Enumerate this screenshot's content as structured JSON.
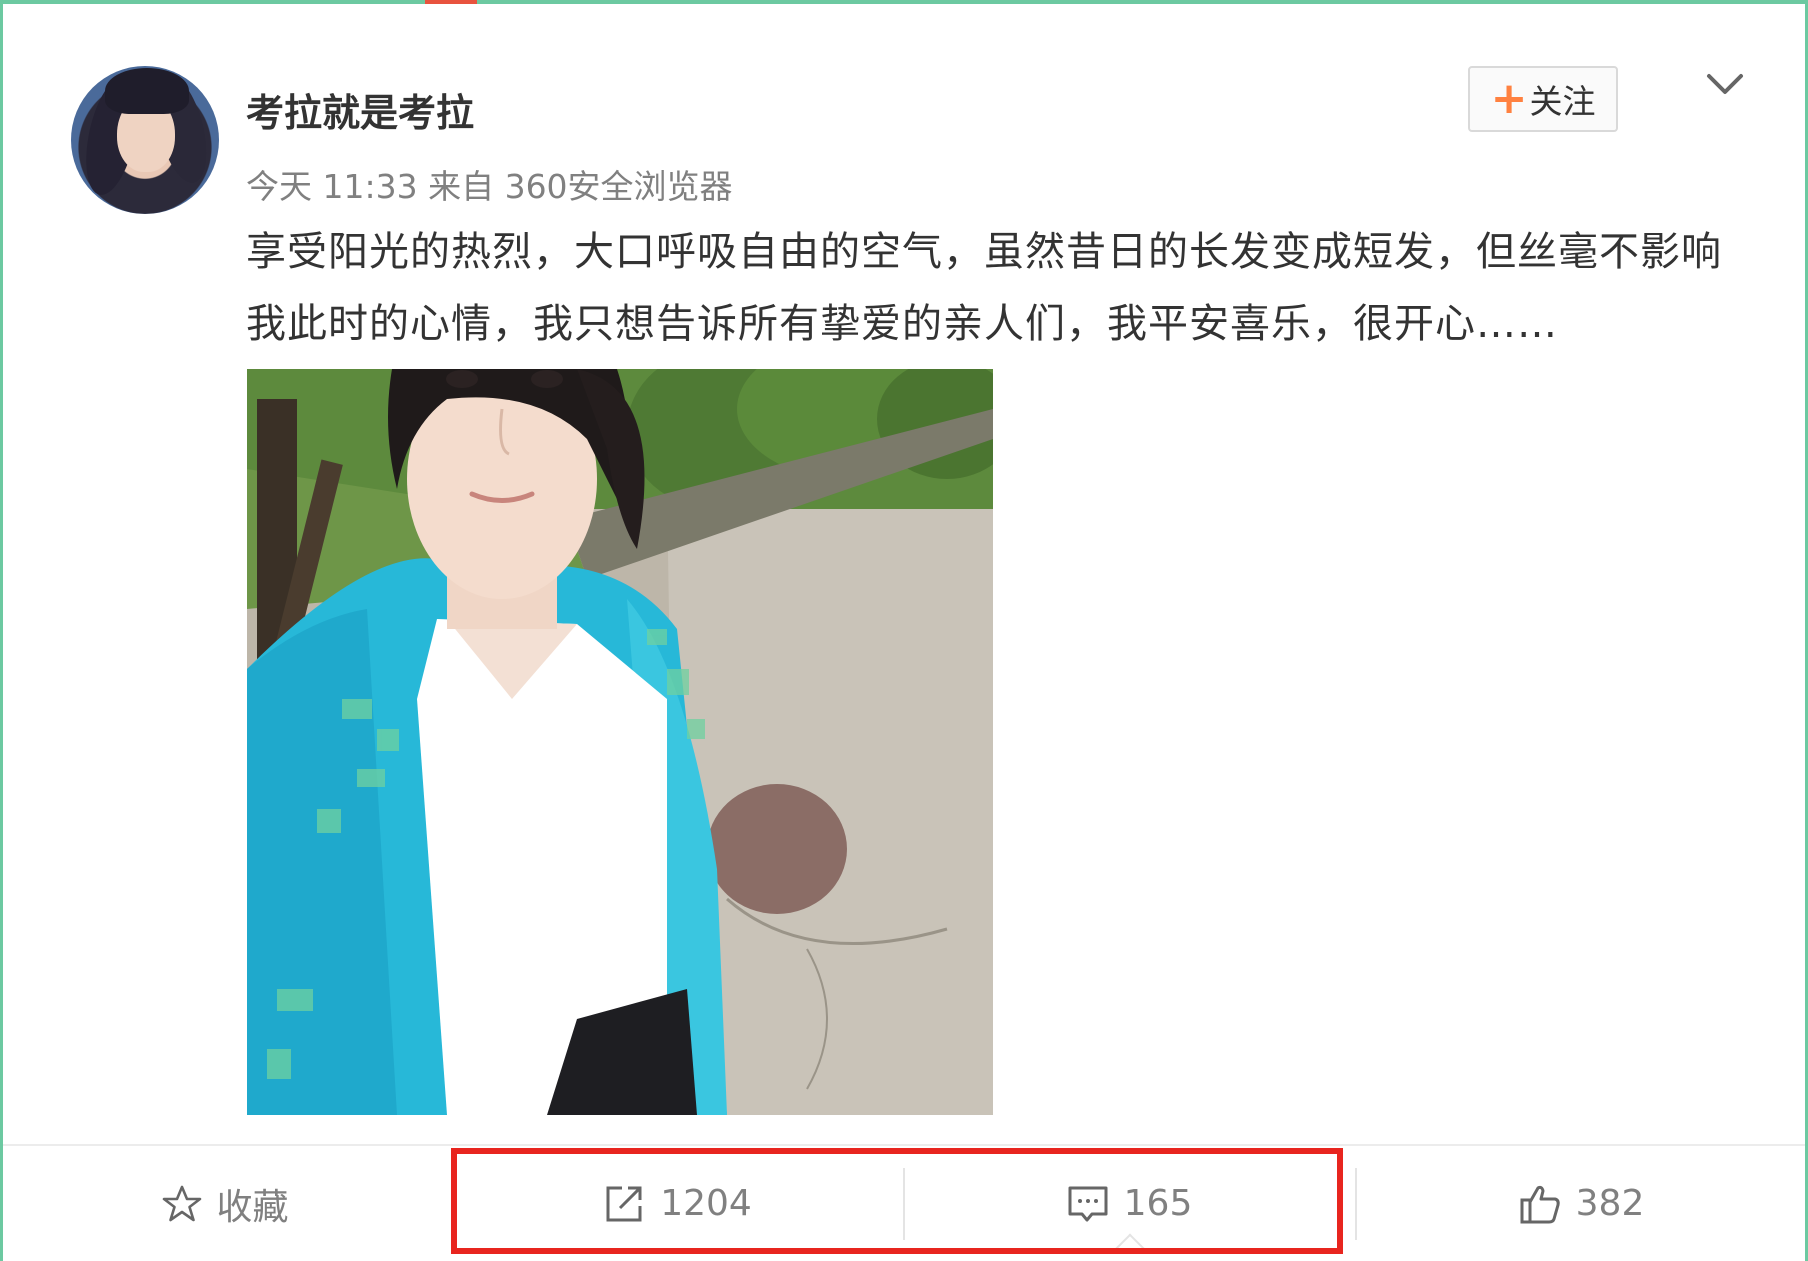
{
  "post": {
    "username": "考拉就是考拉",
    "meta": "今天 11:33 来自 360安全浏览器",
    "follow_label": "关注",
    "text": "享受阳光的热烈，大口呼吸自由的空气，虽然昔日的长发变成短发，但丝毫不影响我此时的心情，我只想告诉所有挚爱的亲人们，我平安喜乐，很开心……"
  },
  "actions": {
    "favorite_label": "收藏",
    "repost_count": "1204",
    "comment_count": "165",
    "like_count": "382"
  },
  "colors": {
    "accent_orange": "#ff8140",
    "highlight_red": "#e8251f",
    "frame_green": "#6cc9a1",
    "text_gray": "#808080"
  }
}
